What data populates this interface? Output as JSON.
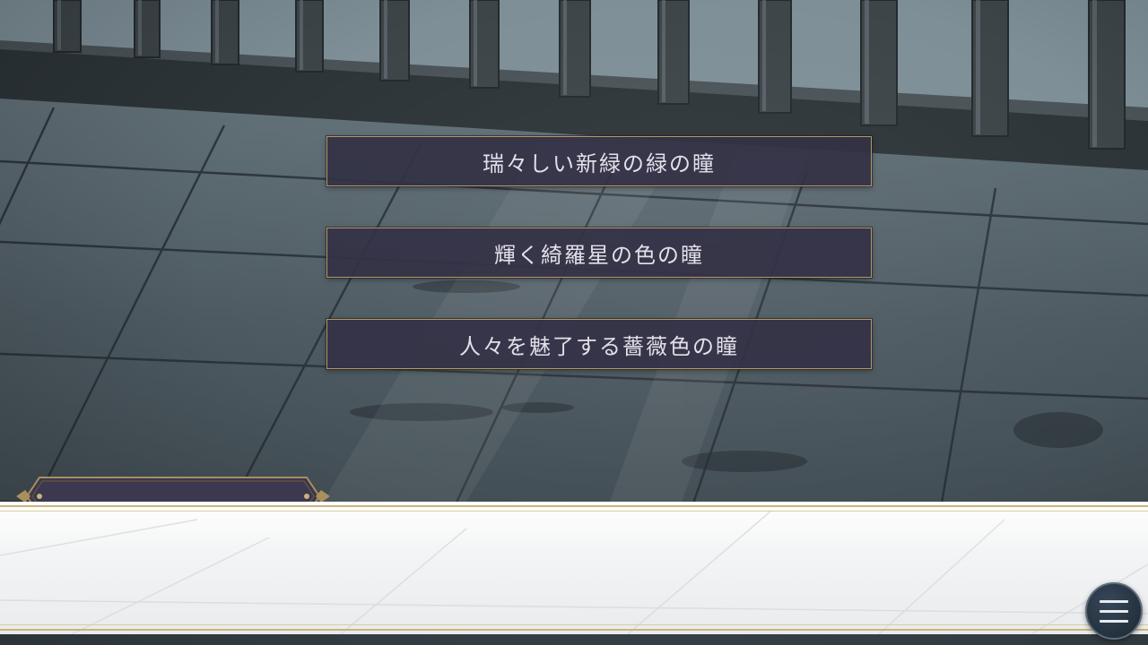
{
  "choices": [
    {
      "label": "瑞々しい新緑の緑の瞳"
    },
    {
      "label": "輝く綺羅星の色の瞳"
    },
    {
      "label": "人々を魅了する薔薇色の瞳"
    }
  ],
  "nameplate": {
    "name": ""
  },
  "message": {
    "text": ""
  },
  "menu": {
    "icon": "hamburger-menu-icon"
  },
  "colors": {
    "choice_bg": "#343246",
    "choice_border": "#b49a63",
    "choice_text": "#e3e0ea",
    "accent_gold": "#c9b37d",
    "menu_button": "#24313e"
  }
}
